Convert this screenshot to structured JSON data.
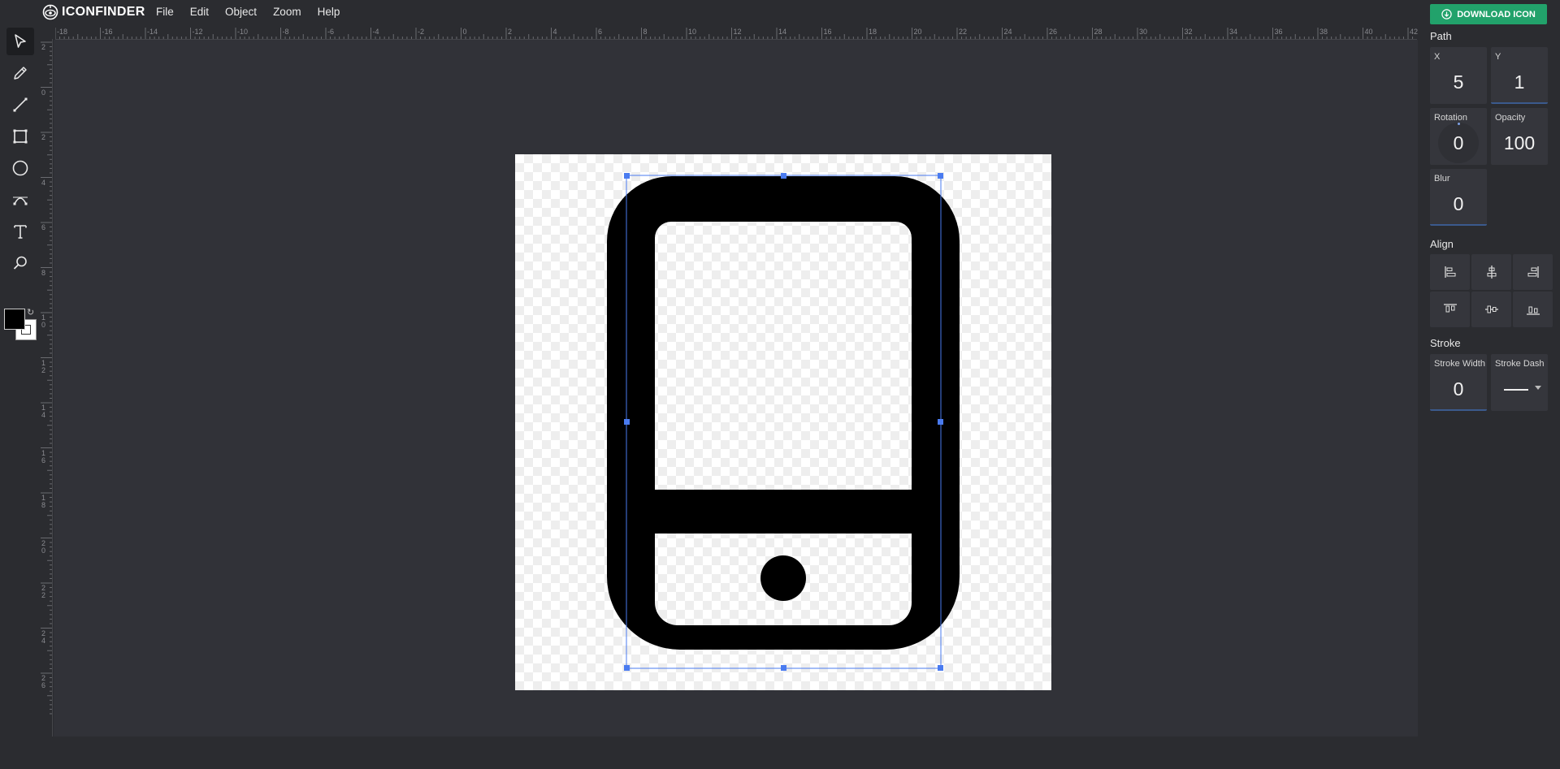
{
  "app": {
    "logo_text": "ICONFINDER"
  },
  "menu": [
    "File",
    "Edit",
    "Object",
    "Zoom",
    "Help"
  ],
  "tools": [
    "select",
    "pencil",
    "line",
    "rectangle",
    "ellipse",
    "path",
    "text",
    "zoom"
  ],
  "colors": {
    "fill": "#000000",
    "stroke": "#ffffff",
    "accent": "#22a26b",
    "selection": "#4a7bf0"
  },
  "ruler_top": [
    "-18",
    "-16",
    "-14",
    "-12",
    "-10",
    "-8",
    "-6",
    "-4",
    "-2",
    "0",
    "2",
    "4",
    "6",
    "8",
    "10",
    "12",
    "14",
    "16",
    "18",
    "20",
    "22",
    "24",
    "26",
    "28",
    "30",
    "32",
    "34",
    "36",
    "38",
    "40",
    "42"
  ],
  "ruler_left": [
    "2",
    "0",
    "2",
    "4",
    "6",
    "8",
    "1 0",
    "1 2",
    "1 4",
    "1 6",
    "1 8",
    "2 0",
    "2 2",
    "2 4",
    "2 6"
  ],
  "panel": {
    "download_label": "DOWNLOAD ICON",
    "path_title": "Path",
    "x": {
      "label": "X",
      "value": "5"
    },
    "y": {
      "label": "Y",
      "value": "1"
    },
    "rotation": {
      "label": "Rotation",
      "value": "0"
    },
    "opacity": {
      "label": "Opacity",
      "value": "100"
    },
    "blur": {
      "label": "Blur",
      "value": "0"
    },
    "align_title": "Align",
    "align_buttons": [
      "align-left",
      "align-center-horizontal",
      "align-right",
      "align-top",
      "align-middle-vertical",
      "align-bottom"
    ],
    "stroke_title": "Stroke",
    "stroke_width": {
      "label": "Stroke Width",
      "value": "0"
    },
    "stroke_dash": {
      "label": "Stroke Dash",
      "value": "solid"
    }
  },
  "canvas": {
    "icon": "smartphone-icon",
    "selected": true
  }
}
